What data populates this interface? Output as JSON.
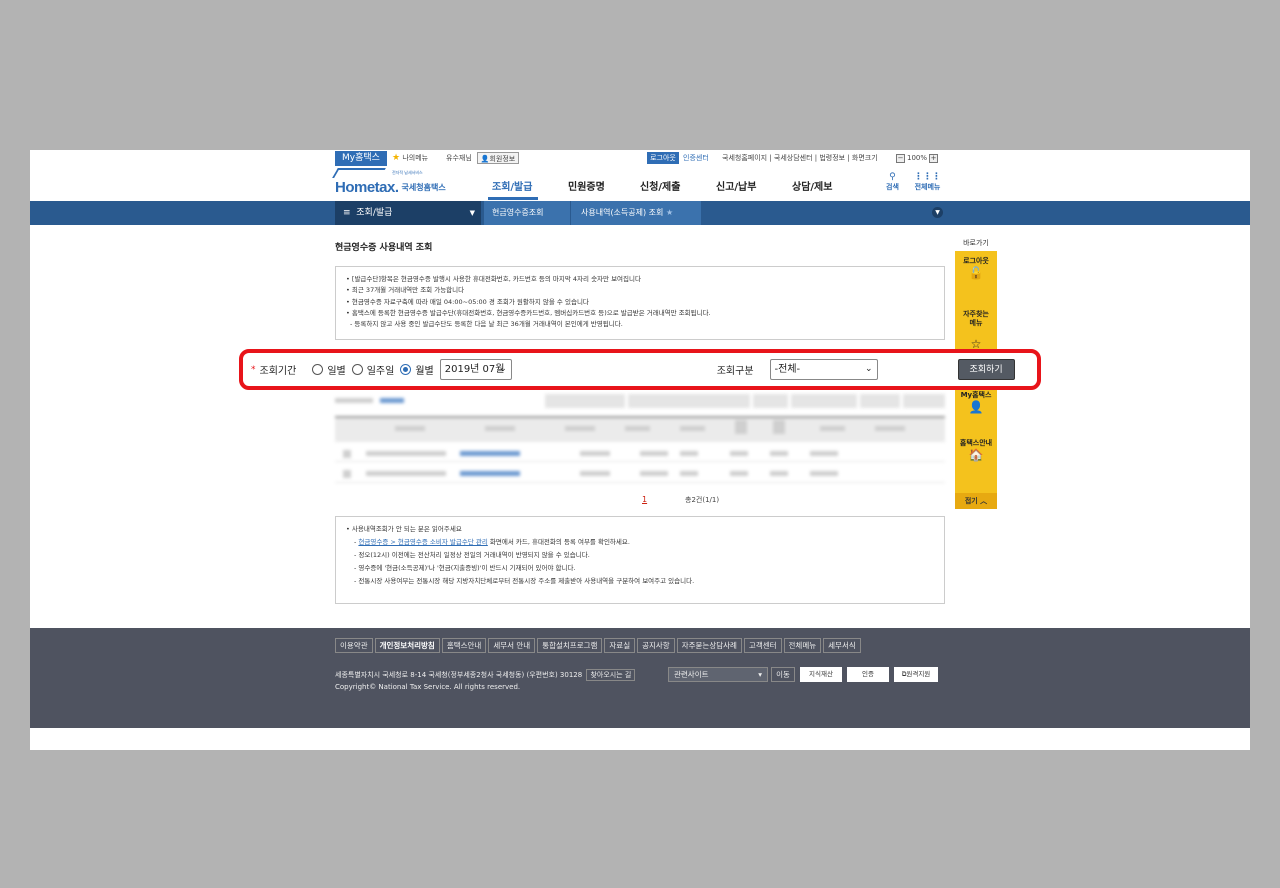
{
  "topbar": {
    "my_hometax": "My홈택스",
    "my_menu": "나의메뉴",
    "user": "유수재님",
    "member_info": "회원정보",
    "logout": "로그아웃",
    "cert": "인증센터",
    "links": "국세청홈페이지 | 국세상담센터 | 법령정보 | 화면크기",
    "zoom": "100%",
    "zoom_minus": "−",
    "zoom_plus": "+"
  },
  "header": {
    "logo_main": "Hometax.",
    "logo_sub": "국세청홈택스",
    "logo_tag": "전자적 납세서비스",
    "menu": [
      "조회/발급",
      "민원증명",
      "신청/제출",
      "신고/납부",
      "상담/제보"
    ],
    "search": "검색",
    "all_menu": "전체메뉴"
  },
  "navbar": {
    "section": "조회/발급",
    "crumb1": "현금영수증조회",
    "crumb2": "사용내역(소득공제) 조회"
  },
  "page": {
    "title": "현금영수증 사용내역 조회",
    "info": [
      "[발급수단]항목은 현금영수증 발행시 사용한 휴대전화번호, 카드번호 등의 마지막 4자리 숫자만 보여집니다",
      "최근 37개월 거래내역만 조회 가능합니다",
      "현금영수증 자료구축에 따라 매일 04:00~05:00 경 조회가 원활하지 않을 수 있습니다",
      "홈택스에 등록한 현금영수증 발급수단(휴대전화번호, 현금영수증카드번호, 멤버십카드번호 등)으로 발급받은 거래내역만 조회됩니다.",
      "- 등록하지 않고 사용 중인 발급수단도 등록한 다음 날 최근 36개월 거래내역이 본인에게 반영됩니다."
    ]
  },
  "form": {
    "required": "*",
    "period_label": "조회기간",
    "daily": "일별",
    "weekly": "일주일",
    "monthly": "월별",
    "month_value": "2019년 07월",
    "type_label": "조회구분",
    "type_value": "-전체-",
    "search_btn": "조회하기"
  },
  "pager": {
    "page": "1",
    "total": "총2건(1/1)"
  },
  "notice": {
    "title": "사용내역조회가 안 되는 분은 읽어주세요",
    "line1_link": "현금영수증 > 현금영수증 소비자 발급수단 관리",
    "line1_rest": " 화면에서 카드, 휴대전화의 등록 여부를 확인하세요.",
    "line2": "- 정오(12시) 이전에는 전산처리 일정상 전일의 거래내역이 반영되지 않을 수 있습니다.",
    "line3": "- 영수증에 '현금(소득공제)'나 '현금(지출증빙)'이 반드시 기재되어 있어야 합니다.",
    "line4": "- 전통시장 사용여부는 전통시장 해당 지방자치단체로부터 전통시장 주소를 제출받아 사용내역을 구분하여 보여주고 있습니다."
  },
  "quick": {
    "title": "바로가기",
    "logout": "로그아웃",
    "fav": "자주찾는\n메뉴",
    "myhometax": "My홈택스",
    "guide": "홈택스안내",
    "close": "접기"
  },
  "footer": {
    "links": [
      "이용약관",
      "개인정보처리방침",
      "홈택스안내",
      "세무서 안내",
      "통합설치프로그램",
      "자료실",
      "공지사항",
      "자주묻는상담사례",
      "고객센터",
      "전체메뉴",
      "세무서식"
    ],
    "address": "세종특별자치시 국세청로 8-14 국세청(정부세종2청사 국세청동) (우편번호) 30128",
    "directions": "찾아오시는 길",
    "copyright": "Copyright© National Tax Service. All rights reserved.",
    "related": "관련사이트",
    "go": "이동",
    "badge1": "지식재산",
    "badge2": "인증",
    "badge3": "원격지원"
  }
}
